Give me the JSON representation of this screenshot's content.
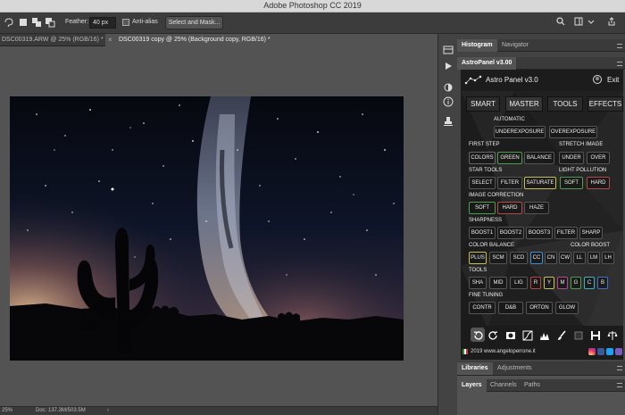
{
  "window": {
    "title": "Adobe Photoshop CC 2019"
  },
  "options": {
    "feather_label": "Feather:",
    "feather_value": "40 px",
    "antialias_label": "Anti-alias",
    "select_mask_label": "Select and Mask..."
  },
  "doc_tabs": [
    {
      "label": "DSC00319.ARW @ 25% (RGB/16) *",
      "close": "×"
    },
    {
      "label": "DSC00319 copy @ 25% (Background copy, RGB/16) *",
      "close": "×"
    }
  ],
  "status": {
    "zoom": "25%",
    "doc": "Doc: 137.3M/503.5M",
    "arrow": "›"
  },
  "panels": {
    "top_tabs": [
      "Histogram",
      "Navigator"
    ],
    "astro_tab": "AstroPanel v3.00",
    "mid_tabs": [
      "Libraries",
      "Adjustments"
    ],
    "bottom_tabs": [
      "Layers",
      "Channels",
      "Paths"
    ]
  },
  "astro": {
    "name": "Astro Panel v3.0",
    "exit": "Exit",
    "exit_icon": "⊗",
    "tabs": [
      "SMART",
      "MASTER",
      "TOOLS",
      "EFFECTS"
    ],
    "automatic": "AUTOMATIC",
    "auto_buttons": [
      "UNDEREXPOSURE",
      "OVEREXPOSURE"
    ],
    "first_step": "FIRST STEP",
    "first_step_buttons": [
      "COLORS",
      "GREEN",
      "BALANCE"
    ],
    "stretch_image": "STRETCH IMAGE",
    "stretch_buttons": [
      "UNDER",
      "OVER"
    ],
    "star_tools": "STAR TOOLS",
    "star_buttons": [
      "SELECT",
      "FILTER",
      "SATURATE"
    ],
    "light_pollution": "LIGHT POLLUTION",
    "lp_buttons": [
      "SOFT",
      "HARD"
    ],
    "image_correction": "IMAGE CORRECTION",
    "ic_buttons": [
      "SOFT",
      "HARD",
      "HAZE"
    ],
    "sharpness": "SHARPNESS",
    "sharp_buttons": [
      "BOOST1",
      "BOOST2",
      "BOOST3",
      "FILTER",
      "SHARP"
    ],
    "color_balance": "COLOR BALANCE",
    "color_boost": "COLOR BOOST",
    "cb_buttons": [
      "PLUS",
      "SCM",
      "SCD",
      "CC",
      "CN",
      "CW",
      "LL",
      "LM",
      "LH"
    ],
    "tools": "TOOLS",
    "tool_buttons": [
      "SHA",
      "MID",
      "LIG",
      "R",
      "Y",
      "M",
      "G",
      "C",
      "B"
    ],
    "fine_tuning": "FINE TUNING",
    "ft_buttons": [
      "CONTR",
      "D&B",
      "ORTON",
      "GLOW"
    ],
    "website": "2019 www.angeloperrone.it"
  }
}
